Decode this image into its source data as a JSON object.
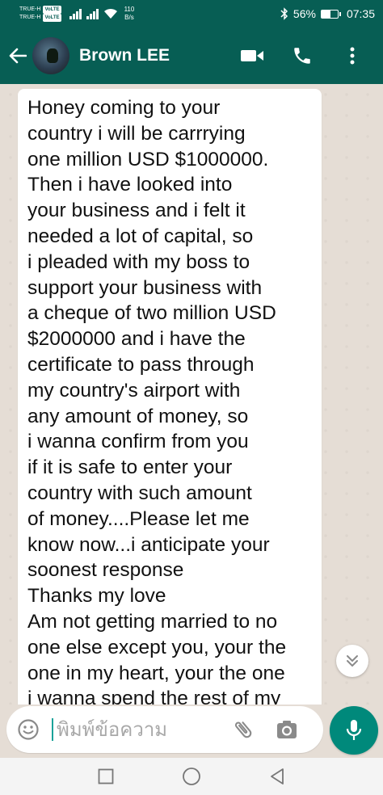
{
  "status_bar": {
    "carrier_1": "TRUE-H",
    "carrier_2": "TRUE-H",
    "volte_1": "VoLTE",
    "volte_2": "VoLTE",
    "speed_value": "110",
    "speed_unit": "B/s",
    "battery_percent": "56%",
    "battery_level": 0.56,
    "time": "07:35"
  },
  "header": {
    "contact_name": "Brown LEE",
    "icons": [
      "back-arrow-icon",
      "video-call-icon",
      "phone-icon",
      "more-vert-icon"
    ]
  },
  "message": {
    "text": "Honey coming to your\ncountry i will be carrrying\none million USD $1000000.\nThen i have looked into\nyour business and i felt it\nneeded a lot of capital, so\ni pleaded with my boss to\nsupport your business with\na cheque of two million USD\n$2000000 and i have the\ncertificate to pass through\nmy country's airport with\nany amount of money, so\ni wanna confirm from you\nif it is safe to enter your\ncountry with such amount\nof money....Please let me\nknow now...i anticipate your\nsoonest response\nThanks my love\nAm not getting married to no\none else except you, your the\none in my heart, your the one\ni wanna spend the rest of my"
  },
  "input": {
    "placeholder": "พิมพ์ข้อความ",
    "value": ""
  },
  "colors": {
    "header": "#075e54",
    "accent": "#00897b",
    "chat_bg": "#e5ddd5",
    "bubble": "#ffffff"
  }
}
